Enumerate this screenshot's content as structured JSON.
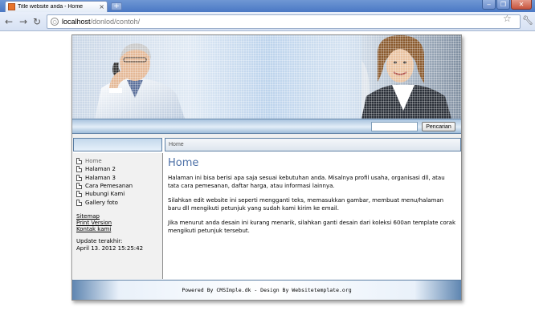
{
  "browser": {
    "tab_title": "Title website anda - Home",
    "url_host": "localhost",
    "url_path": "/donlod/contoh/",
    "icons": {
      "back": "back-arrow-icon",
      "forward": "forward-arrow-icon",
      "reload": "reload-icon",
      "star": "star-icon",
      "wrench": "wrench-icon"
    }
  },
  "search": {
    "value": "",
    "button_label": "Pencarian"
  },
  "breadcrumb": "Home",
  "nav": {
    "items": [
      {
        "label": "Home"
      },
      {
        "label": "Halaman 2"
      },
      {
        "label": "Halaman 3"
      },
      {
        "label": "Cara Pemesanan"
      },
      {
        "label": "Hubungi Kami"
      },
      {
        "label": "Gallery foto"
      }
    ],
    "links": [
      "Sitemap",
      "Print Version",
      "Kontak kami"
    ],
    "update_label": "Update terakhir:",
    "update_value": "April 13. 2012 15:25:42"
  },
  "content": {
    "heading": "Home",
    "paragraphs": [
      "Halaman ini bisa berisi apa saja sesuai kebutuhan anda. Misalnya profil usaha, organisasi dll, atau tata cara pemesanan, daftar harga, atau informasi lainnya.",
      "Silahkan edit website ini seperti mengganti teks, memasukkan gambar, membuat menu/halaman baru dll mengikuti petunjuk yang sudah kami kirim ke email.",
      "Jika menurut anda desain ini kurang menarik, silahkan ganti desain dari koleksi 600an template corak mengikuti petunjuk tersebut."
    ]
  },
  "footer": "Powered By CMSImple.dk - Design By Websitetemplate.org",
  "colors": {
    "titlebar": "#4a78c4",
    "heading": "#4b6fa6",
    "border_blue": "#5c7fa4"
  }
}
